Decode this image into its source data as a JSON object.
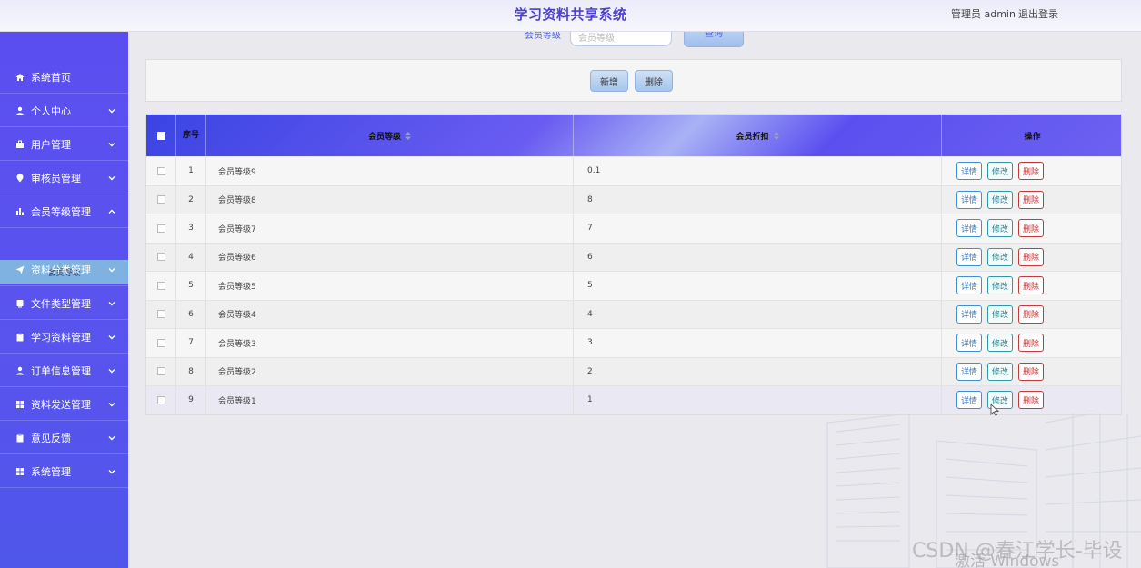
{
  "header": {
    "title": "学习资料共享系统",
    "user": "管理员 admin",
    "logout": "退出登录"
  },
  "sidebar": {
    "items": [
      {
        "label": "系统首页",
        "icon": "home-icon"
      },
      {
        "label": "个人中心",
        "icon": "user-icon"
      },
      {
        "label": "用户管理",
        "icon": "briefcase-icon"
      },
      {
        "label": "审核员管理",
        "icon": "location-icon"
      },
      {
        "label": "会员等级管理",
        "icon": "bar-chart-icon"
      },
      {
        "label": "资料分类管理",
        "icon": "send-icon"
      },
      {
        "label": "文件类型管理",
        "icon": "tablet-icon"
      },
      {
        "label": "学习资料管理",
        "icon": "clipboard-icon"
      },
      {
        "label": "订单信息管理",
        "icon": "user-icon"
      },
      {
        "label": "资料发送管理",
        "icon": "grid-icon"
      },
      {
        "label": "意见反馈",
        "icon": "clipboard-icon"
      },
      {
        "label": "系统管理",
        "icon": "grid-icon"
      }
    ],
    "active_sub": "会员等级"
  },
  "search": {
    "label": "会员等级",
    "placeholder": "会员等级",
    "button": "查询"
  },
  "toolbar": {
    "add": "新增",
    "delete": "删除"
  },
  "table": {
    "headers": {
      "index": "序号",
      "level": "会员等级",
      "discount": "会员折扣",
      "ops": "操作"
    },
    "actions": {
      "detail": "详情",
      "edit": "修改",
      "remove": "删除"
    },
    "rows": [
      {
        "index": "1",
        "level": "会员等级9",
        "discount": "0.1"
      },
      {
        "index": "2",
        "level": "会员等级8",
        "discount": "8"
      },
      {
        "index": "3",
        "level": "会员等级7",
        "discount": "7"
      },
      {
        "index": "4",
        "level": "会员等级6",
        "discount": "6"
      },
      {
        "index": "5",
        "level": "会员等级5",
        "discount": "5"
      },
      {
        "index": "6",
        "level": "会员等级4",
        "discount": "4"
      },
      {
        "index": "7",
        "level": "会员等级3",
        "discount": "3"
      },
      {
        "index": "8",
        "level": "会员等级2",
        "discount": "2"
      },
      {
        "index": "9",
        "level": "会员等级1",
        "discount": "1"
      }
    ]
  },
  "watermark": {
    "csdn": "CSDN @春江学长-毕设",
    "windows": "激活 Windows"
  }
}
